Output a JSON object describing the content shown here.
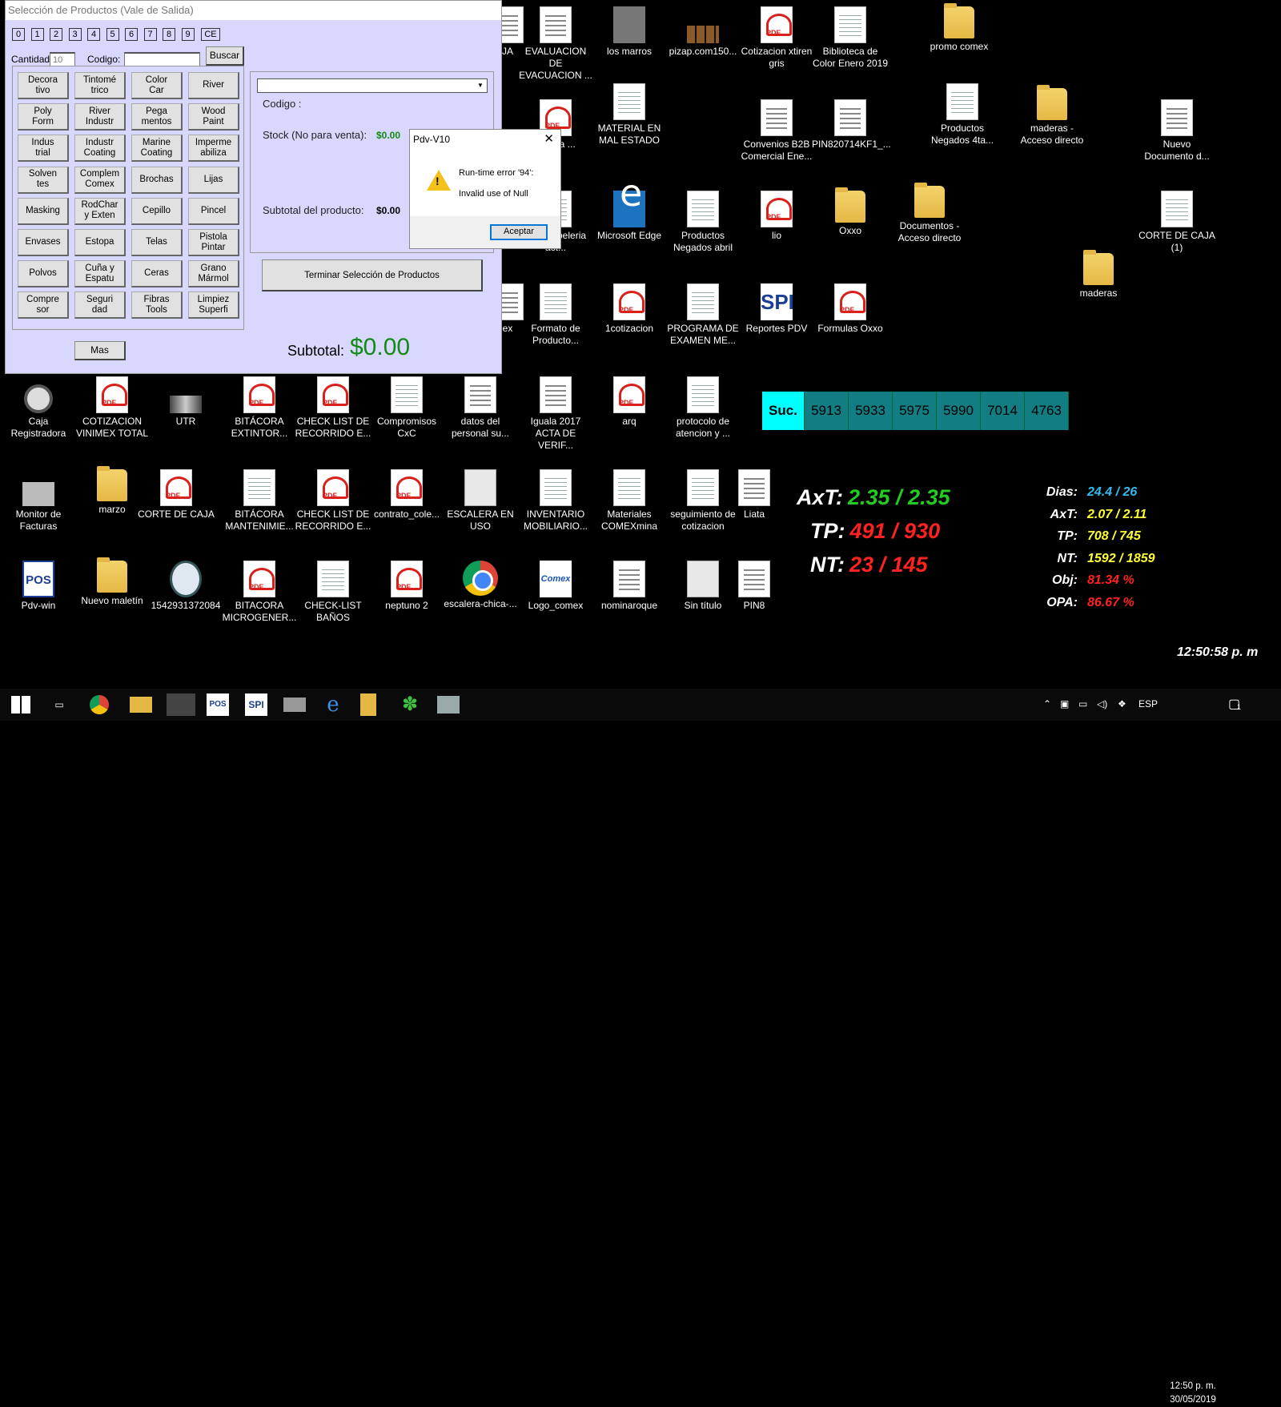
{
  "selection_window": {
    "title": "Selección de Productos (Vale de Salida)",
    "num_keys": [
      "0",
      "1",
      "2",
      "3",
      "4",
      "5",
      "6",
      "7",
      "8",
      "9"
    ],
    "ce_label": "CE",
    "cantidad_label": "Cantidad:",
    "cantidad_value": "10",
    "codigo_label": "Codigo:",
    "codigo_value": "",
    "buscar_label": "Buscar",
    "categories": [
      "Decora\ntivo",
      "Tintomé\ntrico",
      "Color\nCar",
      "River",
      "Poly\nForm",
      "River\nIndustr",
      "Pega\nmentos",
      "Wood\nPaint",
      "Indus\ntrial",
      "Industr\nCoating",
      "Marine\nCoating",
      "Imperme\nabiliza",
      "Solven\ntes",
      "Complem\nComex",
      "Brochas",
      "Lijas",
      "Masking",
      "RodChar\ny Exten",
      "Cepillo",
      "Pincel",
      "Envases",
      "Estopa",
      "Telas",
      "Pistola\nPintar",
      "Polvos",
      "Cuña y\nEspatu",
      "Ceras",
      "Grano\nMármol",
      "Compre\nsor",
      "Seguri\ndad",
      "Fibras\nTools",
      "Limpiez\nSuperfi"
    ],
    "mas_label": "Mas",
    "product_selected": "",
    "codigo_info_label": "Codigo :",
    "stock_label": "Stock (No para venta):",
    "stock_value": "$0.00",
    "subtotal_producto_label": "Subtotal del producto:",
    "subtotal_producto_value": "$0.00",
    "terminar_label": "Terminar Selección de Productos",
    "subtotal_label": "Subtotal:",
    "subtotal_value": "$0.00"
  },
  "error_dialog": {
    "title": "Pdv-V10",
    "line1": "Run-time error '94':",
    "line2": "Invalid use of Null",
    "ok_label": "Aceptar"
  },
  "desktop_icons": [
    {
      "label": "JA",
      "type": "doc"
    },
    {
      "label": "EVALUACION DE EVACUACION ...",
      "type": "doc"
    },
    {
      "label": "los marros",
      "type": "photo"
    },
    {
      "label": "pizap.com150...",
      "type": "strip"
    },
    {
      "label": "Cotizacion xtiren gris",
      "type": "pdf"
    },
    {
      "label": "Biblioteca de Color Enero 2019",
      "type": "sheet"
    },
    {
      "label": "promo comex",
      "type": "folder"
    },
    {
      "label": "o de ia ...",
      "type": "pdf"
    },
    {
      "label": "MATERIAL EN MAL ESTADO",
      "type": "sheet"
    },
    {
      "label": "Convenios B2B Comercial Ene...",
      "type": "doc"
    },
    {
      "label": "PIN820714KF1_...",
      "type": "doc"
    },
    {
      "label": "Productos Negados 4ta...",
      "type": "sheet"
    },
    {
      "label": "maderas - Acceso directo",
      "type": "folder"
    },
    {
      "label": "Nuevo Documento d...",
      "type": "doc"
    },
    {
      "label": "o de papeleria act...",
      "type": "sheet"
    },
    {
      "label": "Microsoft Edge",
      "type": "edge"
    },
    {
      "label": "Productos Negados abril",
      "type": "sheet"
    },
    {
      "label": "lio",
      "type": "pdf"
    },
    {
      "label": "Oxxo",
      "type": "folder"
    },
    {
      "label": "Documentos - Acceso directo",
      "type": "folder"
    },
    {
      "label": "CORTE DE CAJA (1)",
      "type": "sheet"
    },
    {
      "label": "maderas",
      "type": "folder"
    },
    {
      "label": "ex",
      "type": "doc"
    },
    {
      "label": "Formato de Producto...",
      "type": "sheet"
    },
    {
      "label": "1cotizacion",
      "type": "pdf"
    },
    {
      "label": "PROGRAMA DE EXAMEN ME...",
      "type": "sheet"
    },
    {
      "label": "Reportes PDV",
      "type": "spi"
    },
    {
      "label": "Formulas Oxxo",
      "type": "pdf"
    },
    {
      "label": "Caja Registradora",
      "type": "cam"
    },
    {
      "label": "COTIZACION VINIMEX TOTAL",
      "type": "pdf"
    },
    {
      "label": "UTR",
      "type": "gray"
    },
    {
      "label": "BITÁCORA EXTINTOR...",
      "type": "pdf"
    },
    {
      "label": "CHECK LIST DE RECORRIDO E...",
      "type": "pdf"
    },
    {
      "label": "Compromisos CxC",
      "type": "sheet"
    },
    {
      "label": "datos del personal su...",
      "type": "doc"
    },
    {
      "label": "Iguala 2017 ACTA DE VERIF...",
      "type": "doc"
    },
    {
      "label": "arq",
      "type": "pdf"
    },
    {
      "label": "protocolo de atencion y ...",
      "type": "sheet"
    },
    {
      "label": "Monitor de Facturas",
      "type": "printer"
    },
    {
      "label": "marzo",
      "type": "folder"
    },
    {
      "label": "CORTE DE CAJA",
      "type": "pdf"
    },
    {
      "label": "BITÁCORA MANTENIMIE...",
      "type": "sheet"
    },
    {
      "label": "CHECK LIST DE RECORRIDO E...",
      "type": "pdf"
    },
    {
      "label": "contrato_cole...",
      "type": "pdf"
    },
    {
      "label": "ESCALERA EN USO",
      "type": "paint"
    },
    {
      "label": "INVENTARIO MOBILIARIO...",
      "type": "sheet"
    },
    {
      "label": "Materiales COMEXmina",
      "type": "sheet"
    },
    {
      "label": "seguimiento de cotizacion",
      "type": "sheet"
    },
    {
      "label": "Liata",
      "type": "doc"
    },
    {
      "label": "Pdv-win",
      "type": "pos"
    },
    {
      "label": "Nuevo maletín",
      "type": "folder"
    },
    {
      "label": "1542931372084",
      "type": "seal"
    },
    {
      "label": "BITACORA MICROGENER...",
      "type": "pdf"
    },
    {
      "label": "CHECK-LIST BAÑOS",
      "type": "sheet"
    },
    {
      "label": "neptuno 2",
      "type": "pdf"
    },
    {
      "label": "escalera-chica-...",
      "type": "chrome"
    },
    {
      "label": "Logo_comex",
      "type": "comex"
    },
    {
      "label": "nominaroque",
      "type": "doc"
    },
    {
      "label": "Sin título",
      "type": "paint"
    },
    {
      "label": "PIN8",
      "type": "doc"
    }
  ],
  "sucursales": {
    "head": "Suc.",
    "items": [
      "5913",
      "5933",
      "5975",
      "5990",
      "7014",
      "4763"
    ]
  },
  "big_stats": [
    {
      "label": "AxT:",
      "value": "2.35 / 2.35",
      "color": "#22cc22"
    },
    {
      "label": "TP:",
      "value": "491 / 930",
      "color": "#ff2222"
    },
    {
      "label": "NT:",
      "value": "23 / 145",
      "color": "#ff2222"
    }
  ],
  "small_stats": [
    {
      "label": "Dias:",
      "value": "24.4 / 26",
      "color": "#33bbee"
    },
    {
      "label": "AxT:",
      "value": "2.07 / 2.11",
      "color": "#ffff33"
    },
    {
      "label": "TP:",
      "value": "708 / 745",
      "color": "#ffff33"
    },
    {
      "label": "NT:",
      "value": "1592 / 1859",
      "color": "#ffff33"
    },
    {
      "label": "Obj:",
      "value": "81.34 %",
      "color": "#ff2222"
    },
    {
      "label": "OPA:",
      "value": "86.67 %",
      "color": "#ff2222"
    }
  ],
  "desktop_clock": "12:50:58 p. m",
  "taskbar": {
    "apps": [
      "windows-start",
      "task-view",
      "chrome",
      "file-explorer",
      "caja-registradora",
      "pdv-win",
      "spi-reportes",
      "printer",
      "internet-explorer",
      "folder",
      "green-flower",
      "terminal"
    ],
    "language": "ESP",
    "time": "12:50 p. m.",
    "date": "30/05/2019",
    "notification_count": "1"
  }
}
